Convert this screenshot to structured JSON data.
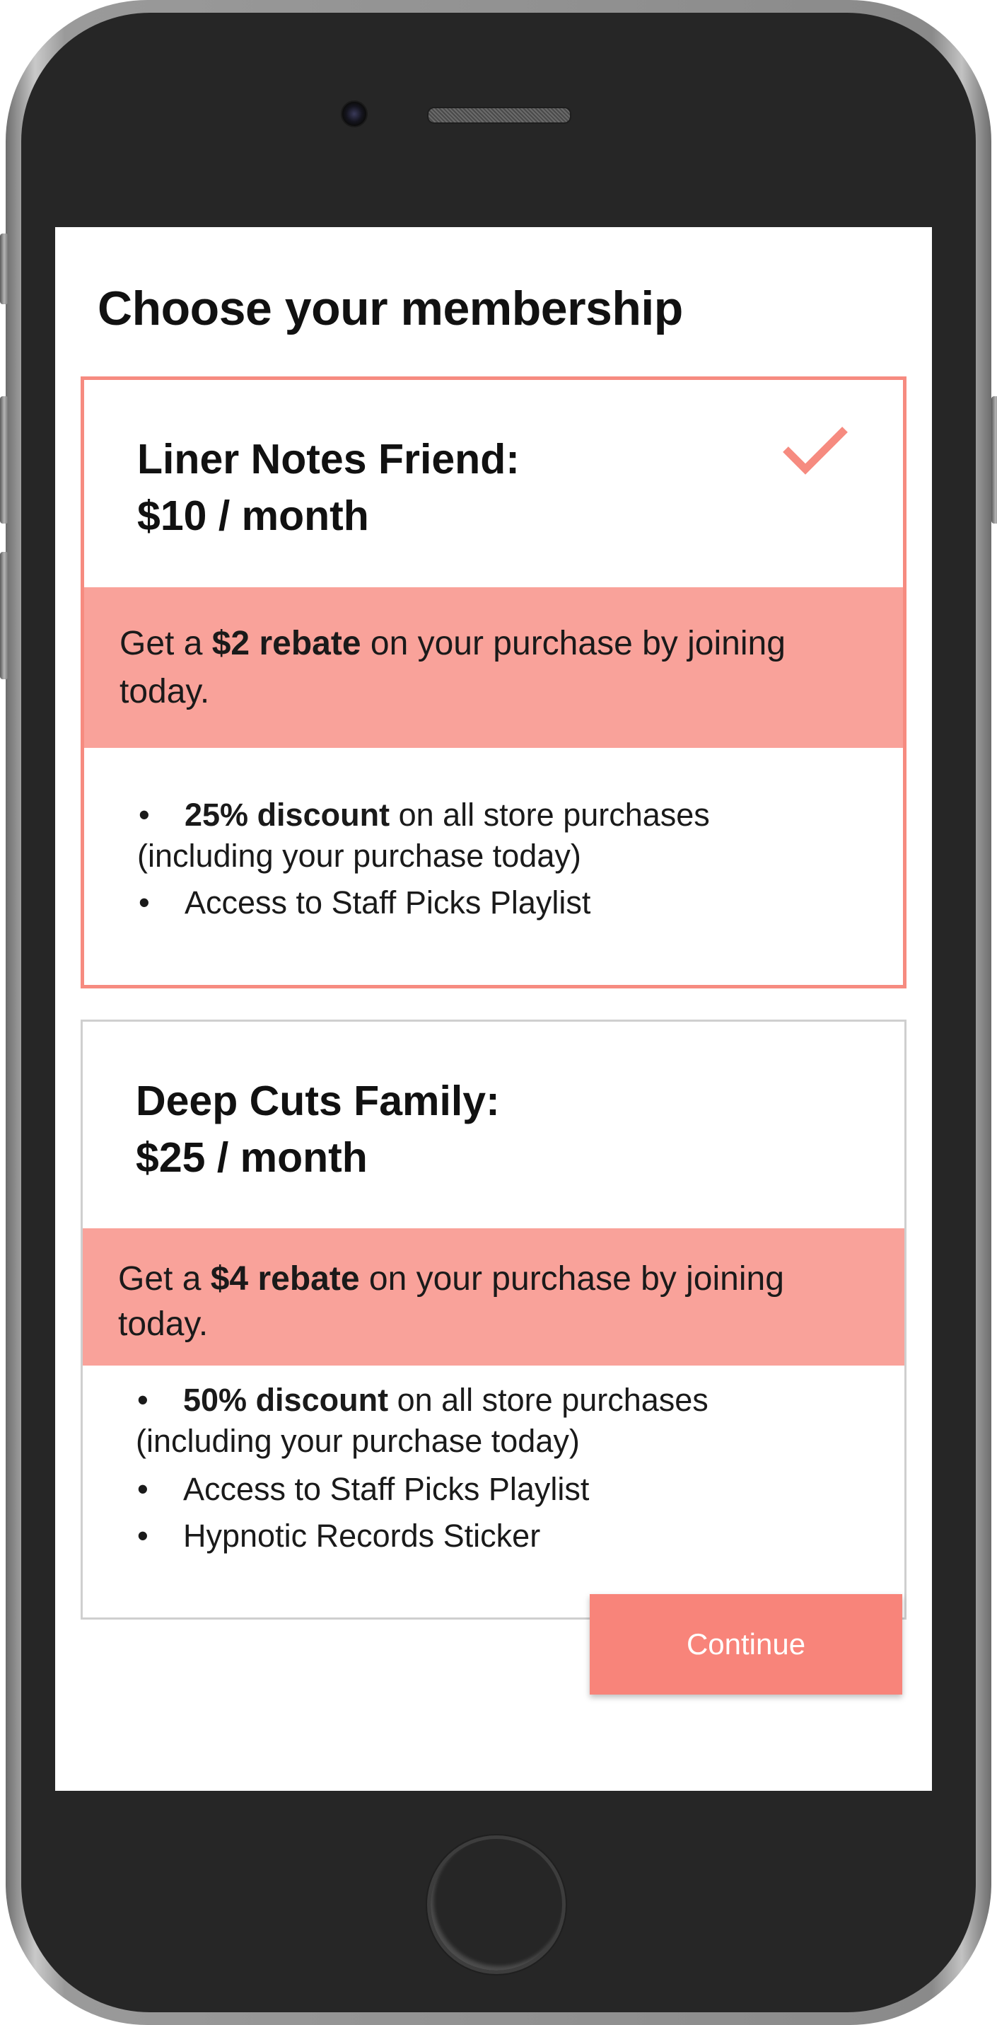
{
  "page": {
    "title": "Choose your membership"
  },
  "plans": [
    {
      "name": "Liner Notes Friend:",
      "price": "$10 / month",
      "selected": true,
      "rebate": {
        "prefix": "Get a ",
        "amount": "$2 rebate",
        "suffix": " on your purchase by joining today."
      },
      "benefits": [
        {
          "bold": "25% discount",
          "text": " on all store purchases",
          "continuation": "(including your purchase today)"
        },
        {
          "bold": "",
          "text": "Access to Staff Picks Playlist",
          "continuation": ""
        }
      ]
    },
    {
      "name": "Deep Cuts Family:",
      "price": "$25 / month",
      "selected": false,
      "rebate": {
        "prefix": "Get a ",
        "amount": "$4 rebate",
        "suffix": " on your purchase by joining today."
      },
      "benefits": [
        {
          "bold": "50% discount",
          "text": " on all store purchases",
          "continuation": "(including your purchase today)"
        },
        {
          "bold": "",
          "text": "Access to Staff Picks Playlist",
          "continuation": ""
        },
        {
          "bold": "",
          "text": "Hypnotic Records Sticker",
          "continuation": ""
        }
      ]
    }
  ],
  "actions": {
    "continue_label": "Continue"
  },
  "icons": {
    "selected_check": "checkmark-icon",
    "bullet": "•"
  },
  "colors": {
    "accent": "#f68b80",
    "rebate_band": "#f9a29a",
    "button": "#f8847a",
    "phone_body": "#262626"
  }
}
